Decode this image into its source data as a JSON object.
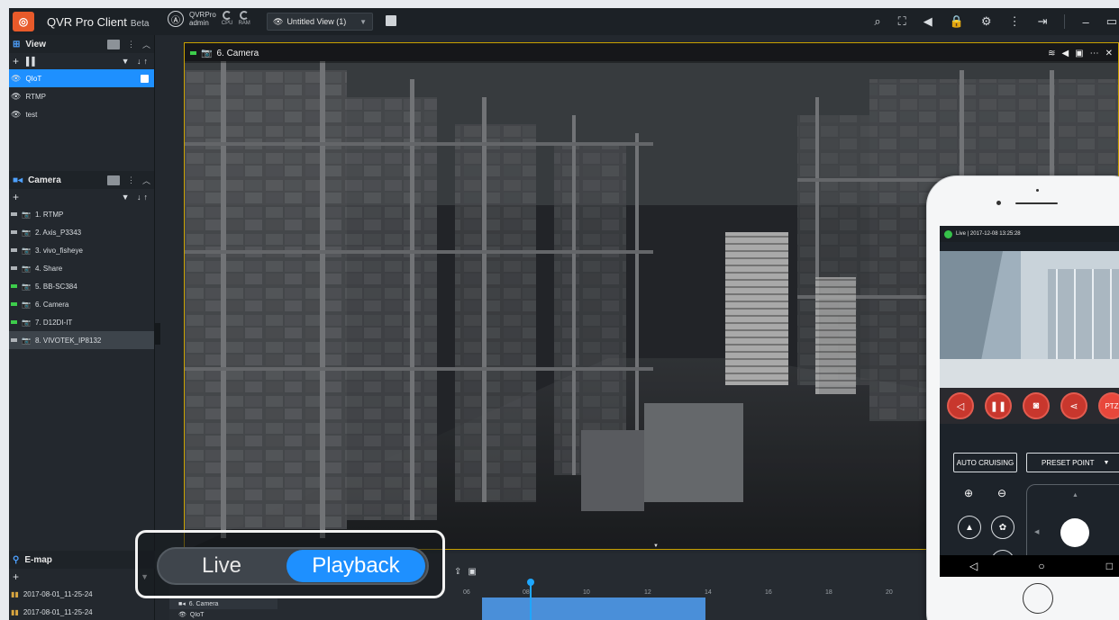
{
  "app": {
    "title": "QVR Pro Client",
    "beta": "Beta"
  },
  "user": {
    "server": "QVRPro",
    "name": "admin",
    "cpu_label": "CPU",
    "ram_label": "RAM"
  },
  "view_select": {
    "value": "Untitled View (1)"
  },
  "sidebar": {
    "view_panel": {
      "title": "View",
      "items": [
        {
          "label": "QIoT",
          "selected": true
        },
        {
          "label": "RTMP"
        },
        {
          "label": "test"
        }
      ]
    },
    "camera_panel": {
      "title": "Camera",
      "items": [
        {
          "label": "1. RTMP",
          "status": "gray"
        },
        {
          "label": "2. Axis_P3343",
          "status": "gray"
        },
        {
          "label": "3. vivo_fisheye",
          "status": "gray"
        },
        {
          "label": "4. Share",
          "status": "gray"
        },
        {
          "label": "5. BB-SC384",
          "status": "green"
        },
        {
          "label": "6. Camera",
          "status": "green"
        },
        {
          "label": "7. D12DI-IT",
          "status": "green"
        },
        {
          "label": "8. VIVOTEK_IP8132",
          "status": "gray",
          "selected": true
        }
      ]
    },
    "emap_panel": {
      "title": "E-map",
      "items": [
        {
          "label": "2017-08-01_11-25-24"
        },
        {
          "label": "2017-08-01_11-25-24"
        }
      ]
    }
  },
  "video": {
    "channel_title": "6. Camera"
  },
  "mode_toggle": {
    "live": "Live",
    "playback": "Playback",
    "active": "playback"
  },
  "timeline": {
    "ticks": [
      "06",
      "08",
      "10",
      "12",
      "14",
      "16",
      "18",
      "20"
    ],
    "rows": [
      "6. Camera",
      "QIoT"
    ]
  },
  "phone": {
    "status": "Live | 2017-12-08 13:25:28",
    "buttons": {
      "auto_cruising": "AUTO CRUISING",
      "preset_point": "PRESET POINT",
      "ptz": "PTZ"
    }
  },
  "colors": {
    "accent": "#1e90ff",
    "frame_border": "#c9a100",
    "control_red": "#c8372d"
  }
}
